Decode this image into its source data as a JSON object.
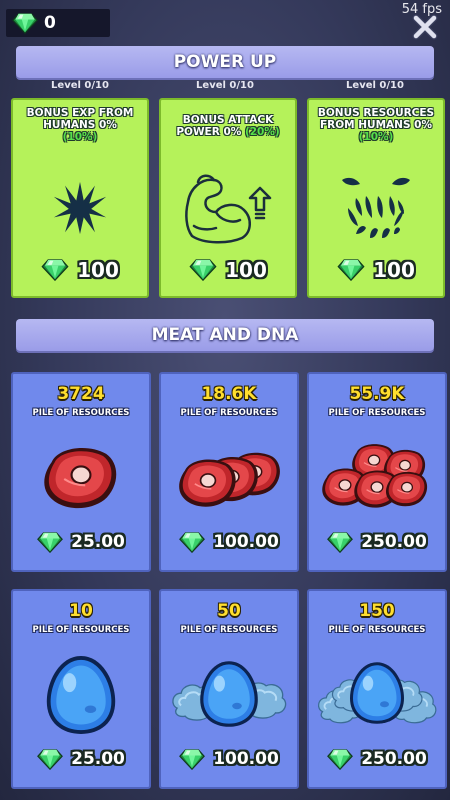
{
  "topbar": {
    "gem_count": "0",
    "fps": "54 fps",
    "gem_icon": "gem-icon",
    "close_icon": "close-icon"
  },
  "power_up": {
    "header": "POWER UP",
    "cards": [
      {
        "level": "Level 0/10",
        "title": "BONUS EXP FROM HUMANS 0%",
        "bonus": "(10%)",
        "icon": "burst-icon",
        "price": "100"
      },
      {
        "level": "Level 0/10",
        "title": "BONUS ATTACK POWER 0%",
        "bonus": "(20%)",
        "icon": "muscle-arm-icon",
        "price": "100"
      },
      {
        "level": "Level 0/10",
        "title": "BONUS RESOURCES FROM HUMANS 0%",
        "bonus": "(10%)",
        "icon": "monster-teeth-icon",
        "price": "100"
      }
    ]
  },
  "meat_dna": {
    "header": "MEAT AND DNA",
    "cards": [
      {
        "amount": "3724",
        "subtitle": "PILE OF RESOURCES",
        "icon": "meat-steak-icon",
        "price": "25.00"
      },
      {
        "amount": "18.6K",
        "subtitle": "PILE OF RESOURCES",
        "icon": "meat-stack-icon",
        "price": "100.00"
      },
      {
        "amount": "55.9K",
        "subtitle": "PILE OF RESOURCES",
        "icon": "meat-pile-icon",
        "price": "250.00"
      },
      {
        "amount": "10",
        "subtitle": "PILE OF RESOURCES",
        "icon": "dna-egg-icon",
        "price": "25.00"
      },
      {
        "amount": "50",
        "subtitle": "PILE OF RESOURCES",
        "icon": "dna-egg-stack-icon",
        "price": "100.00"
      },
      {
        "amount": "150",
        "subtitle": "PILE OF RESOURCES",
        "icon": "dna-egg-pile-icon",
        "price": "250.00"
      }
    ]
  },
  "colors": {
    "power_card_bg": "#b5f25a",
    "resource_card_bg": "#7089ec",
    "header_bg": "#a8aaee",
    "amount_yellow": "#ffde2e",
    "gem_green": "#4be07a"
  }
}
